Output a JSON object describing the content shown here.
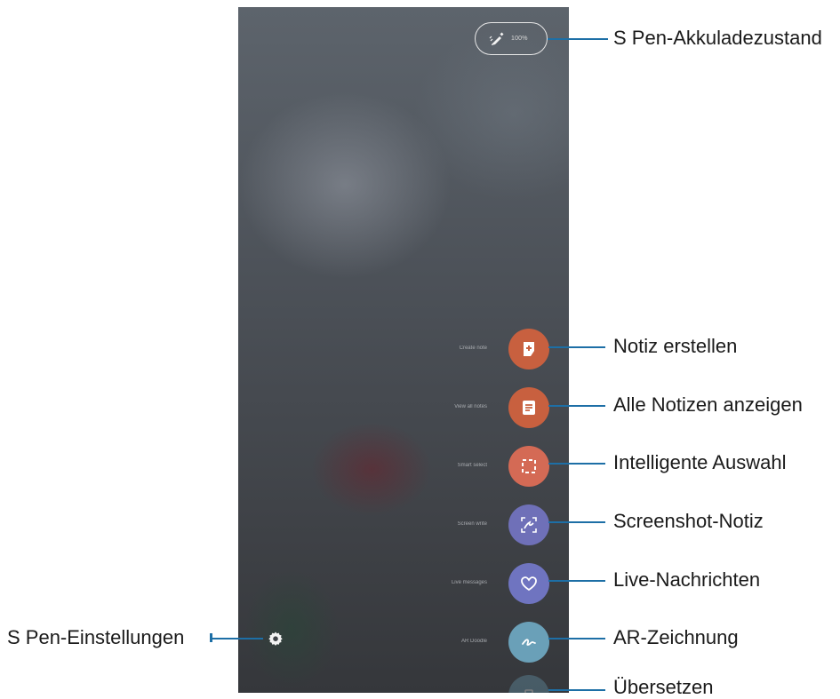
{
  "phone": {
    "battery_level": "100%",
    "menu": [
      {
        "label": "Create note",
        "icon": "add-note-icon",
        "color": "#c8603f"
      },
      {
        "label": "View all notes",
        "icon": "notes-list-icon",
        "color": "#c8603f"
      },
      {
        "label": "Smart select",
        "icon": "smart-select-icon",
        "color": "#d46a55"
      },
      {
        "label": "Screen write",
        "icon": "screen-write-icon",
        "color": "#6f70b8"
      },
      {
        "label": "Live messages",
        "icon": "heart-icon",
        "color": "#6f74c0"
      },
      {
        "label": "AR Doodle",
        "icon": "doodle-icon",
        "color": "#6aa0b8"
      },
      {
        "label": "",
        "icon": "translate-icon",
        "color": "#6aa0b8"
      }
    ],
    "settings_icon": "gear-icon"
  },
  "callouts": {
    "battery": "S Pen-Akkuladezustand",
    "items": [
      "Notiz erstellen",
      "Alle Notizen anzeigen",
      "Intelligente Auswahl",
      "Screenshot-Notiz",
      "Live-Nachrichten",
      "AR-Zeichnung",
      "Übersetzen"
    ],
    "settings": "S Pen-Einstellungen"
  },
  "colors": {
    "callout_line": "#1d6fa6"
  }
}
